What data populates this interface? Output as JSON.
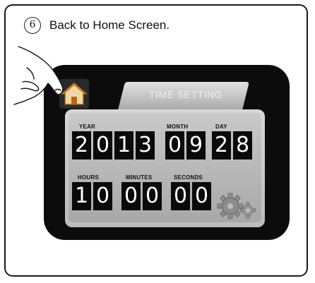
{
  "instruction": {
    "step_number": "6",
    "text": "Back to Home Screen."
  },
  "screen": {
    "tab_title": "TIME SETTING",
    "date": {
      "year_label": "YEAR",
      "year_digits": [
        "2",
        "0",
        "1",
        "3"
      ],
      "month_label": "MONTH",
      "month_digits": [
        "0",
        "9"
      ],
      "day_label": "DAY",
      "day_digits": [
        "2",
        "8"
      ]
    },
    "time": {
      "hours_label": "HOURS",
      "hours_digits": [
        "1",
        "0"
      ],
      "minutes_label": "MINUTES",
      "minutes_digits": [
        "0",
        "0"
      ],
      "seconds_label": "SECONDS",
      "seconds_digits": [
        "0",
        "0"
      ]
    },
    "icons": {
      "home": "home-icon",
      "settings": "gear-icon",
      "pointer": "pointing-hand"
    },
    "colors": {
      "device_bezel": "#0c0c0c",
      "panel": "#c9c9c9",
      "digit_box": "#0a0a0a",
      "house_roof": "#c8781e"
    }
  }
}
